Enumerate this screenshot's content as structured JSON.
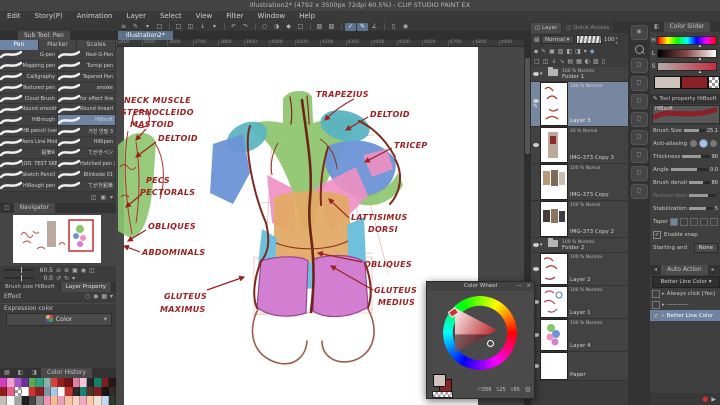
{
  "title_bar": {
    "title": "Illustration2* (4792 x 3500px 72dpi 60.5%)  -  CLIP STUDIO PAINT EX"
  },
  "menu_bar": [
    "Edit",
    "Story(P)",
    "Animation",
    "Layer",
    "Select",
    "View",
    "Filter",
    "Window",
    "Help"
  ],
  "command_bar": [
    {
      "g": "≡",
      "n": "palette-dock-icon"
    },
    {
      "g": "✎",
      "n": "operation-mode-icon"
    },
    {
      "g": "▾",
      "n": "operation-dropdown-icon"
    },
    {
      "g": "□",
      "n": "tablet-mode-icon"
    },
    {
      "sep": true
    },
    {
      "g": "□",
      "n": "new-file-icon"
    },
    {
      "g": "◫",
      "n": "open-file-icon"
    },
    {
      "g": "↓",
      "n": "save-file-icon"
    },
    {
      "g": "▾",
      "n": "save-dropdown-icon"
    },
    {
      "sep": true
    },
    {
      "g": "↶",
      "n": "undo-icon"
    },
    {
      "g": "↷",
      "n": "redo-icon"
    },
    {
      "sep": true
    },
    {
      "g": "○",
      "n": "deselect-icon"
    },
    {
      "g": "◑",
      "n": "invert-selection-icon"
    },
    {
      "g": "◆",
      "n": "expand-selection-icon"
    },
    {
      "g": "□",
      "n": "clear-icon"
    },
    {
      "sep": true
    },
    {
      "g": "▧",
      "n": "snap-to-ruler-icon"
    },
    {
      "g": "▨",
      "n": "snap-to-special-ruler-icon"
    },
    {
      "sep": true
    },
    {
      "g": "✓",
      "n": "snap-on-icon",
      "active": true
    },
    {
      "g": "✎",
      "n": "pen-snap-icon",
      "active": true
    },
    {
      "g": "∠",
      "n": "rotate-angle-icon"
    },
    {
      "sep": true
    },
    {
      "g": "▯",
      "n": "light-table-icon"
    },
    {
      "g": "◉",
      "n": "reference-icon"
    }
  ],
  "document_tab": {
    "label": "Illustration2*"
  },
  "ruler": {
    "ticks": [
      "3400",
      "3500",
      "3600",
      "3700",
      "3800",
      "3900",
      "4000",
      "4100",
      "4200",
      "4300",
      "4400",
      "4500",
      "4600",
      "4700",
      "4800",
      "4900"
    ]
  },
  "sub_tool": {
    "header": "Sub Tool: Pen",
    "tabs": [
      {
        "label": "Pen",
        "selected": true
      },
      {
        "label": "Marker",
        "selected": false
      },
      {
        "label": "Scales",
        "selected": false
      }
    ],
    "brushes_left": [
      "G-pen",
      "Mapping pen",
      "Calligraphy",
      "Textured pen",
      "Cloud Brush",
      "Round smooth 2",
      "HiBrough",
      "HB pencil (ver 2)",
      "Aero Line Mod",
      "鉛筆R",
      "JOO. TEST SKETCH",
      "Sketch Pencil",
      "HiRough pen"
    ],
    "brushes_right": [
      "Real G-Pen",
      "Turnip pen",
      "Tapered Pen",
      "smoke",
      "for effect line",
      "Round lineart",
      "HiBsoft",
      "거친 연필 3",
      "HiRipen",
      "てがきペン",
      "Hatched pen 2",
      "Blinkode 01",
      "てがき鉛筆"
    ],
    "selected_brush": "HiBsoft",
    "footer_icons": [
      {
        "g": "◫",
        "n": "add-subtool-icon"
      },
      {
        "g": "▣",
        "n": "duplicate-subtool-icon"
      },
      {
        "g": "▾",
        "n": "subtool-menu-icon"
      }
    ]
  },
  "navigator": {
    "tab": "Navigator",
    "zoom_value": "60.5",
    "rotation_value": "0.0",
    "zoom_icons": [
      {
        "g": "⊖",
        "n": "zoom-out-icon"
      },
      {
        "g": "⊕",
        "n": "zoom-in-icon"
      },
      {
        "g": "▣",
        "n": "fit-to-screen-icon"
      },
      {
        "g": "◉",
        "n": "actual-size-icon"
      },
      {
        "g": "◫",
        "n": "flip-view-icon"
      }
    ],
    "rotate_icons": [
      {
        "g": "↺",
        "n": "rotate-left-icon"
      },
      {
        "g": "↻",
        "n": "rotate-right-icon"
      },
      {
        "g": "▾",
        "n": "reset-rotation-icon"
      }
    ]
  },
  "left_props": {
    "tab_brush_size": "Brush size HiBsoft",
    "tab_layer_property": "Layer Property",
    "effect_label": "Effect",
    "effect_icons": [
      {
        "g": "○",
        "n": "border-effect-icon"
      },
      {
        "g": "◉",
        "n": "tone-effect-icon"
      },
      {
        "g": "▦",
        "n": "extract-line-icon"
      },
      {
        "g": "▾",
        "n": "effect-menu-icon"
      }
    ],
    "expression_label": "Expression color",
    "expression_value": "Color"
  },
  "color_history": {
    "tab": "Color History",
    "swatches": [
      "#cf3fbf",
      "#ef9fd0",
      "#a855cc",
      "#6c2f9a",
      "#59a94e",
      "#2da184",
      "#86b4ad",
      "#d94040",
      "#9a1f1f",
      "#6e1616",
      "#e07fa7",
      "#f2c4d6",
      "#262626",
      "#13806d",
      "#7d1d1d",
      "#241a1a",
      "#8f1a1a",
      "#df6089",
      "checker",
      "#ffffff",
      "#cc3333",
      "#8c2020",
      "#7e93a8",
      "#a9c9e2",
      "#f5f5f5",
      "#c23030",
      "#2e2727",
      "#1c8070",
      "#54332c",
      "#7c1f1f",
      "#161616",
      "#332a2a",
      "#c6beb6",
      "#f7f7f7",
      "#a3a3a3",
      "#1d1d1d",
      "#454545",
      "#8e8e8e",
      "#ef93b4",
      "#f2bb92",
      "#eaa0bb",
      "#f3c2a2",
      "#f8d2c2",
      "#f0a9c2",
      "#f9c9aa",
      "#f1e1d2",
      "#c5daf0",
      "#2b3a2b"
    ]
  },
  "canvas": {
    "labels": [
      "NECK MUSCLE",
      "STERNOCLEIDO",
      "MASTOID",
      "DELTOID",
      "PECS",
      "PECTORALS",
      "OBLIQUES",
      "ABDOMINALS",
      "TRAPEZIUS",
      "DELTOID",
      "TRICEP",
      "LATTISIMUS",
      "DORSI",
      "OBLIQUES",
      "GLUTEUS",
      "MEDIUS",
      "GLUTEUS",
      "MAXIMUS"
    ]
  },
  "layer_panel": {
    "tabs": [
      {
        "label": "Layer",
        "selected": true
      },
      {
        "label": "Quick Access",
        "selected": false
      }
    ],
    "blend_mode": "Normal",
    "opacity": "100",
    "tools_row1": [
      {
        "g": "▪",
        "n": "pin-icon"
      },
      {
        "g": "✎",
        "n": "draft-layer-icon"
      },
      {
        "g": "▣",
        "n": "lock-layer-icon"
      },
      {
        "g": "▨",
        "n": "lock-transparent-icon"
      },
      {
        "g": "◧",
        "n": "enable-mask-icon"
      },
      {
        "g": "◨",
        "n": "set-ruler-icon"
      },
      {
        "g": "▾",
        "n": "clip-at-layer-icon"
      },
      {
        "g": "◆",
        "n": "layer-color-icon",
        "colored": true
      }
    ],
    "tools_row2": [
      {
        "g": "□",
        "n": "new-raster-layer-icon"
      },
      {
        "g": "◫",
        "n": "new-folder-icon"
      },
      {
        "g": "↓",
        "n": "transfer-layer-icon"
      },
      {
        "g": "↘",
        "n": "merge-down-icon"
      },
      {
        "g": "▤",
        "n": "combine-copy-icon"
      },
      {
        "g": "▦",
        "n": "divide-layer-icon"
      },
      {
        "g": "◐",
        "n": "layer-mask-icon"
      },
      {
        "g": "▧",
        "n": "apply-mask-icon"
      },
      {
        "g": "▯",
        "n": "delete-layer-icon"
      }
    ],
    "layers": [
      {
        "type": "folder",
        "opacity": "100 % Normal",
        "name": "Folder 1",
        "eye": true
      },
      {
        "type": "sketch",
        "opacity": "100 % Normal",
        "name": "Layer 3",
        "eye": true,
        "selected": true,
        "editing": true
      },
      {
        "type": "photo1",
        "opacity": "40 % Nomal",
        "name": "IMG-373 Copy 3",
        "eye": true
      },
      {
        "type": "photo2",
        "opacity": "100 % Nomal",
        "name": "IMG-373 Copy",
        "eye": false
      },
      {
        "type": "photo3",
        "opacity": "100 % Nomal",
        "name": "IMG-373 Copy 2",
        "eye": false
      },
      {
        "type": "folder",
        "opacity": "100 % Normal",
        "name": "Folder 2",
        "eye": true
      },
      {
        "type": "sketch2",
        "opacity": "100 % Normal",
        "name": "Layer 2",
        "eye": true
      },
      {
        "type": "sketch3",
        "opacity": "100 % Normal",
        "name": "Layer 1",
        "eye": true
      },
      {
        "type": "color",
        "opacity": "100 % Normal",
        "name": "Layer 4",
        "eye": true
      },
      {
        "type": "paper",
        "opacity": "",
        "name": "Paper",
        "eye": true
      }
    ]
  },
  "material_strip": {
    "category_count": 8
  },
  "color_slider": {
    "tab": "Color Slider",
    "rows": [
      "H",
      "L",
      "S"
    ]
  },
  "tool_property": {
    "tab": "Tool property HiBsoft",
    "brush_name": "HiBsoft",
    "rows": [
      {
        "label": "Brush Size",
        "value": "25.1",
        "type": "slider"
      },
      {
        "label": "Anti-aliasing",
        "type": "options"
      },
      {
        "label": "Thickness",
        "value": "90",
        "type": "slider"
      },
      {
        "label": "Angle",
        "value": "0.0",
        "type": "slider"
      },
      {
        "label": "Brush density",
        "value": "80",
        "type": "slider"
      },
      {
        "label": "Texture density",
        "value": "",
        "type": "slider",
        "disabled": true
      },
      {
        "label": "Stabilization",
        "value": "5",
        "type": "slider"
      },
      {
        "label": "Taper",
        "type": "taper"
      },
      {
        "label": "Enable snapping",
        "type": "check",
        "checked": true
      },
      {
        "label": "Starting and ending",
        "value": "None",
        "type": "button"
      }
    ]
  },
  "auto_action": {
    "tab": "Auto Action",
    "preset": "Better Line Color",
    "items": [
      {
        "label": "Always click [Yes]",
        "checked": false,
        "selected": false
      },
      {
        "label": "————",
        "checked": false,
        "selected": false
      },
      {
        "label": "Better Line Color",
        "checked": true,
        "selected": true
      }
    ]
  },
  "color_wheel": {
    "title": "Color Wheel",
    "h_label": "H",
    "h": "356",
    "s_label": "S",
    "s": "25",
    "v_label": "V",
    "v": "65"
  },
  "colors": {
    "selection": "#76879f",
    "label_ink": "#9b2020",
    "main_color": "#cfc3bf",
    "sub_color": "#8c2125",
    "canvas_bg": "#ffffff",
    "pasteboard": "#474747"
  }
}
